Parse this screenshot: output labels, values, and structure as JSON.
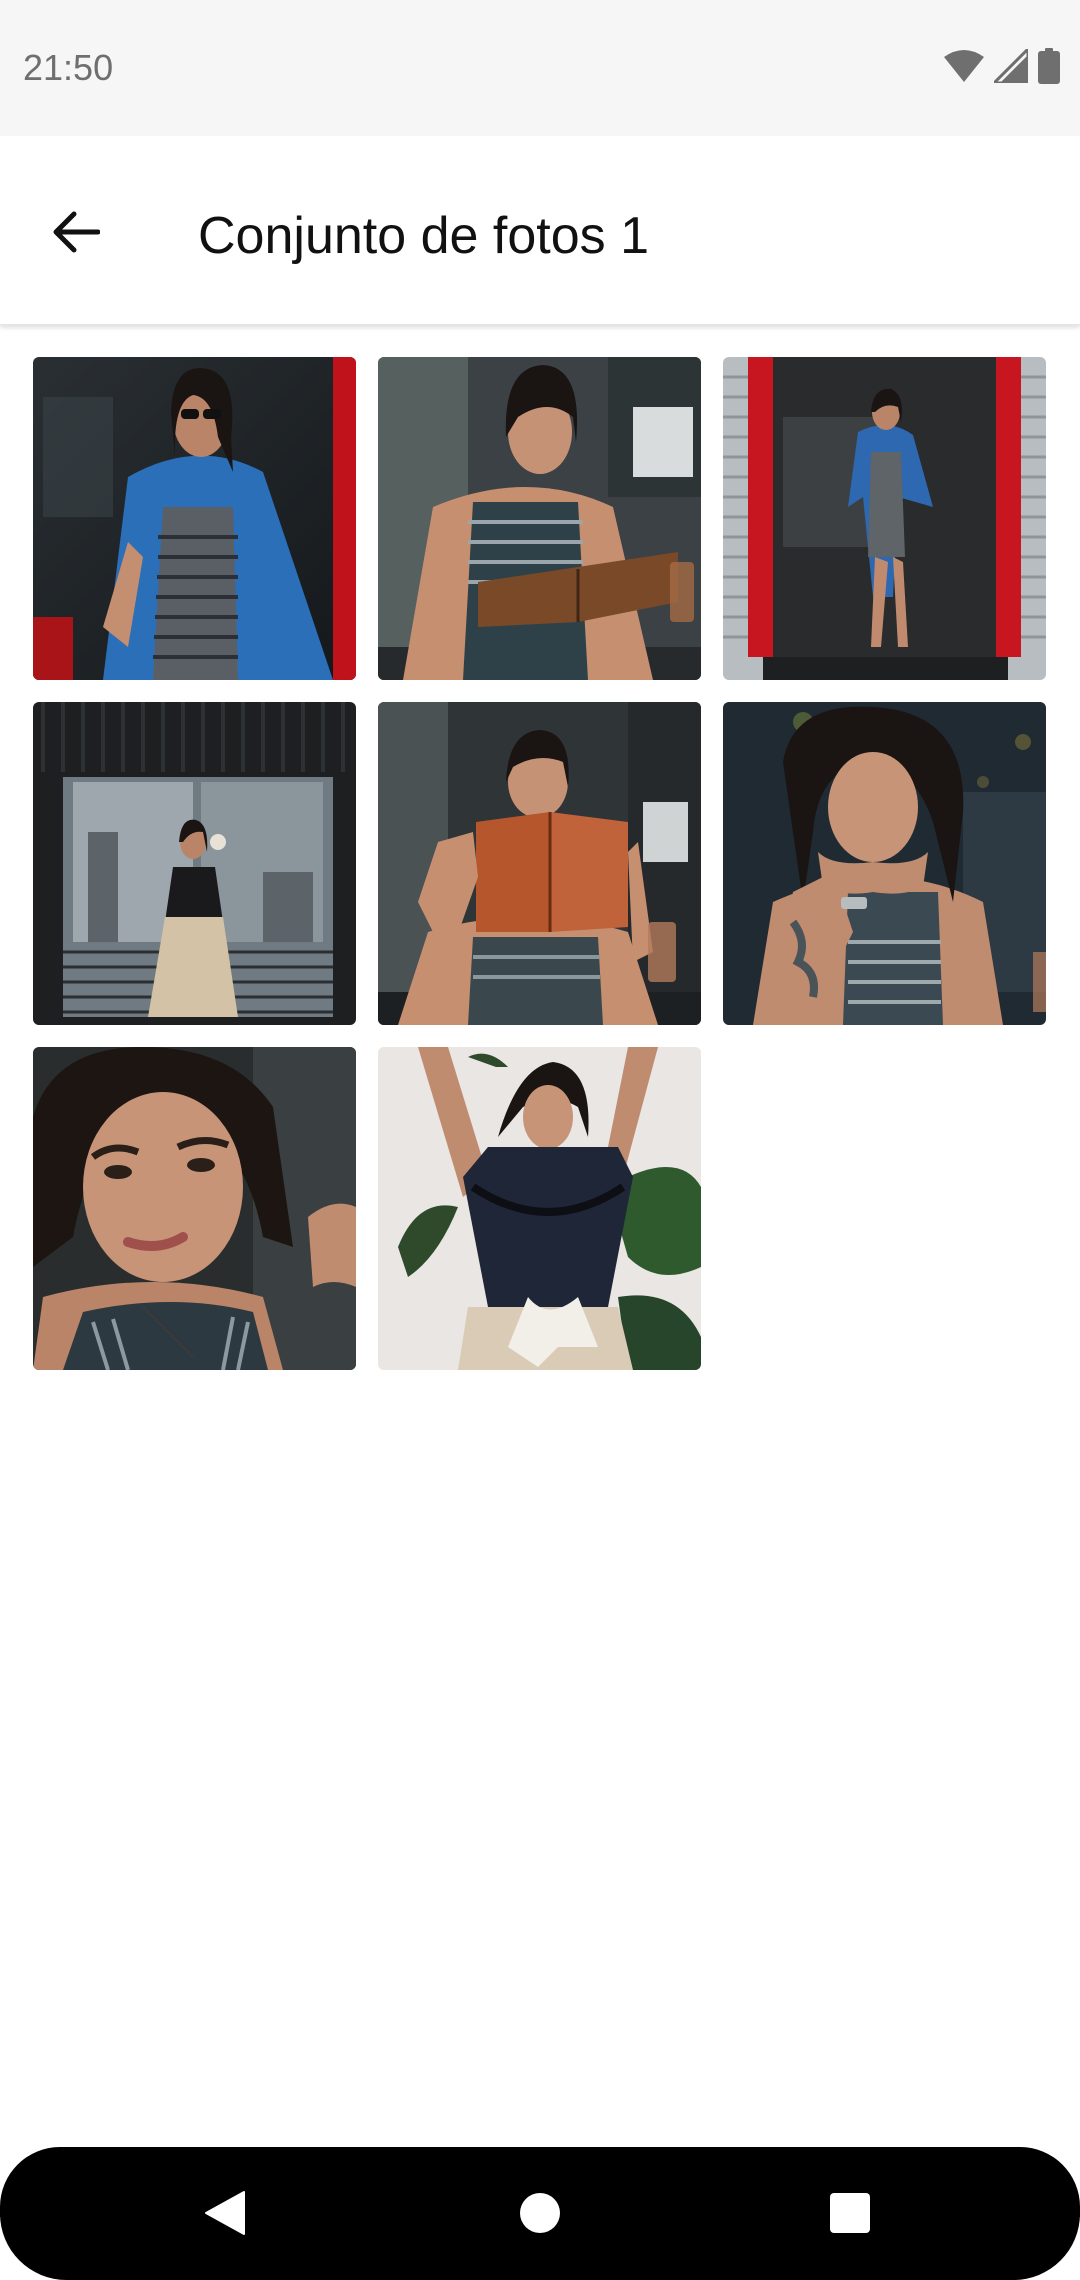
{
  "status_bar": {
    "time": "21:50",
    "icons": [
      "wifi-icon",
      "cell-signal-icon",
      "battery-icon"
    ]
  },
  "app_bar": {
    "back_icon": "arrow-back-icon",
    "title": "Conjunto de fotos 1"
  },
  "gallery": {
    "photo_count": 8,
    "photos": [
      {
        "name": "photo-1",
        "description_icon": "woman-denim-jacket-sunglasses"
      },
      {
        "name": "photo-2",
        "description_icon": "woman-holding-book-cafe"
      },
      {
        "name": "photo-3",
        "description_icon": "woman-red-doorway"
      },
      {
        "name": "photo-4",
        "description_icon": "woman-window-coffee"
      },
      {
        "name": "photo-5",
        "description_icon": "woman-reading-red-book"
      },
      {
        "name": "photo-6",
        "description_icon": "woman-chin-on-hands"
      },
      {
        "name": "photo-7",
        "description_icon": "woman-portrait-closeup"
      },
      {
        "name": "photo-8",
        "description_icon": "woman-arms-raised-plant"
      }
    ]
  },
  "nav_bar": {
    "back_icon": "nav-back-triangle-icon",
    "home_icon": "nav-home-circle-icon",
    "recents_icon": "nav-recents-square-icon"
  },
  "colors": {
    "status_bar_bg": "#f6f6f6",
    "title_text": "#111111",
    "nav_bar_bg": "#000000"
  }
}
